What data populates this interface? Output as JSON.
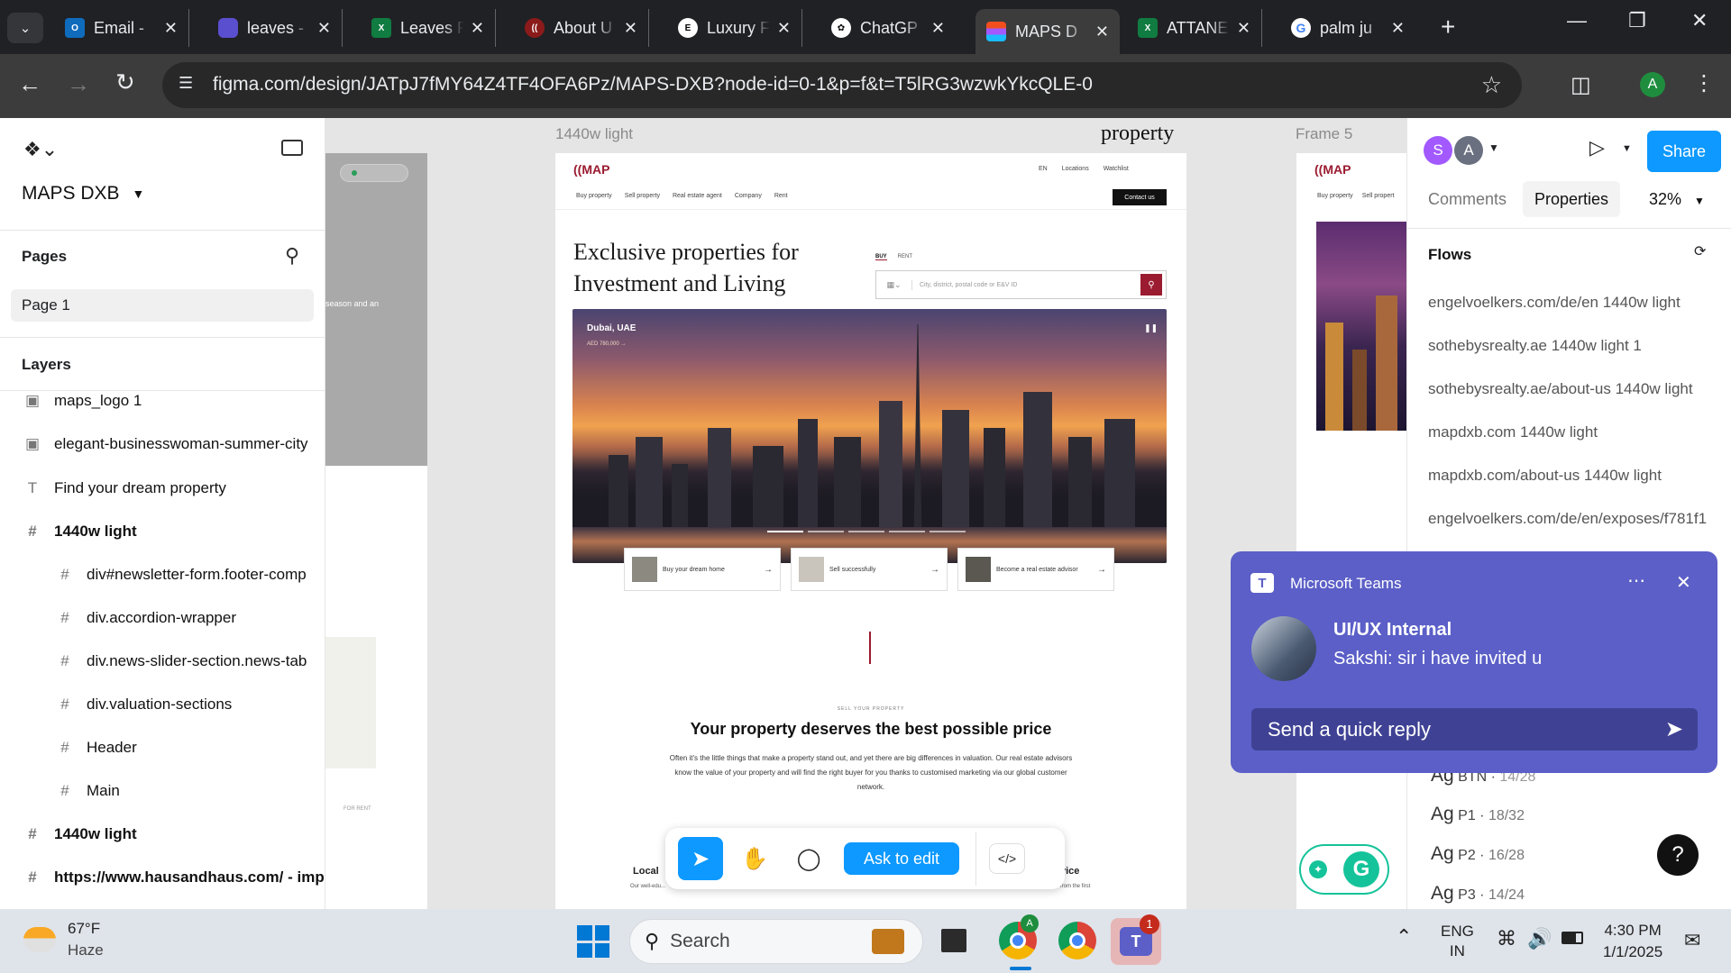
{
  "browser": {
    "tabs": [
      {
        "title": "Email - ",
        "icon": "outlook-icon",
        "color": "#0f6cbd"
      },
      {
        "title": "leaves - ",
        "icon": "copilot-icon",
        "color": "#5a4fcf"
      },
      {
        "title": "Leaves F",
        "icon": "excel-icon",
        "color": "#107c41"
      },
      {
        "title": "About U",
        "icon": "maps-brand-icon",
        "color": "#8b1a1a"
      },
      {
        "title": "Luxury F",
        "icon": "ev-icon",
        "color": "#ffffff"
      },
      {
        "title": "ChatGP",
        "icon": "chatgpt-icon",
        "color": "#ffffff"
      },
      {
        "title": "MAPS D",
        "icon": "figma-icon",
        "color": "#f24e1e"
      },
      {
        "title": "ATTANE",
        "icon": "excel-icon",
        "color": "#107c41"
      },
      {
        "title": "palm ju",
        "icon": "google-icon",
        "color": "#4285f4"
      }
    ],
    "url": "figma.com/design/JATpJ7fMY64Z4TF4OFA6Pz/MAPS-DXB?node-id=0-1&p=f&t=T5lRG3wzwkYkcQLE-0",
    "profile_initial": "A"
  },
  "figma_left": {
    "file_name": "MAPS DXB",
    "pages_title": "Pages",
    "page_1": "Page 1",
    "layers_title": "Layers",
    "layers": [
      {
        "name": "maps_logo 1",
        "icon": "image-icon"
      },
      {
        "name": "elegant-businesswoman-summer-city",
        "icon": "image-icon"
      },
      {
        "name": "Find your dream property",
        "icon": "text-icon"
      },
      {
        "name": "1440w light",
        "icon": "frame-icon"
      },
      {
        "name": "div#newsletter-form.footer-comp",
        "icon": "frame-icon"
      },
      {
        "name": "div.accordion-wrapper",
        "icon": "frame-icon"
      },
      {
        "name": "div.news-slider-section.news-tab",
        "icon": "frame-icon"
      },
      {
        "name": "div.valuation-sections",
        "icon": "frame-icon"
      },
      {
        "name": "Header",
        "icon": "frame-icon"
      },
      {
        "name": "Main",
        "icon": "frame-icon"
      },
      {
        "name": "1440w light",
        "icon": "frame-icon"
      },
      {
        "name": "https://www.hausandhaus.com/ - imp",
        "icon": "frame-icon"
      }
    ]
  },
  "canvas": {
    "frame_label_main": "1440w light",
    "frame_label_property": "property",
    "frame_label_right": "Frame 5",
    "left_frame_text": "season and an",
    "left_frame_tag": "FOR RENT",
    "site": {
      "logo": "MAP",
      "top_links": [
        "EN",
        "Locations",
        "Watchlist"
      ],
      "nav": [
        "Buy property",
        "Sell property",
        "Real estate agent",
        "Company",
        "Rent"
      ],
      "contact": "Contact us",
      "headline_1": "Exclusive properties for",
      "headline_2": "Investment and Living",
      "search_tabs": [
        "BUY",
        "RENT"
      ],
      "search_placeholder": "City, district, postal code or E&V ID",
      "hero_location": "Dubai, UAE",
      "hero_price": "AED 780,000 →",
      "cards": [
        "Buy your dream home",
        "Sell successfully",
        "Become a real estate advisor"
      ],
      "sell_kicker": "SELL YOUR PROPERTY",
      "sell_title": "Your property deserves the best possible price",
      "sell_body": "Often it's the little things that make a property stand out, and yet there are big differences in valuation. Our real estate advisors know the value of your property and will find the right buyer for you thanks to customised marketing via our global customer network.",
      "local_title": "Local",
      "local_body": "Our well-edu...",
      "vice_title": "vice",
      "vice_body": "from the first"
    },
    "right_frame": {
      "nav": [
        "Buy property",
        "Sell propert"
      ]
    },
    "toolbar": {
      "ask_to_edit": "Ask to edit"
    }
  },
  "figma_right": {
    "avatars": [
      "S",
      "A"
    ],
    "share": "Share",
    "tab_comments": "Comments",
    "tab_properties": "Properties",
    "zoom": "32%",
    "flows_title": "Flows",
    "flows": [
      "engelvoelkers.com/de/en 1440w light",
      "sothebysrealty.ae 1440w light 1",
      "sothebysrealty.ae/about-us 1440w light ",
      "mapdxb.com 1440w light",
      "mapdxb.com/about-us 1440w light",
      "engelvoelkers.com/de/en/exposes/f781f1"
    ],
    "typestyles": [
      {
        "label": "Ag",
        "name": "BTN",
        "size": "14/28"
      },
      {
        "label": "Ag",
        "name": "P1",
        "size": "18/32"
      },
      {
        "label": "Ag",
        "name": "P2",
        "size": "16/28"
      },
      {
        "label": "Ag",
        "name": "P3",
        "size": "14/24"
      }
    ],
    "help": "?"
  },
  "teams": {
    "app": "Microsoft Teams",
    "group": "UI/UX Internal",
    "message": "Sakshi: sir i have invited u",
    "reply_placeholder": "Send a quick reply"
  },
  "taskbar": {
    "temp": "67°F",
    "weather": "Haze",
    "search": "Search",
    "lang_1": "ENG",
    "lang_2": "IN",
    "time": "4:30 PM",
    "date": "1/1/2025",
    "teams_badge": "1",
    "chrome_badge": "A"
  }
}
